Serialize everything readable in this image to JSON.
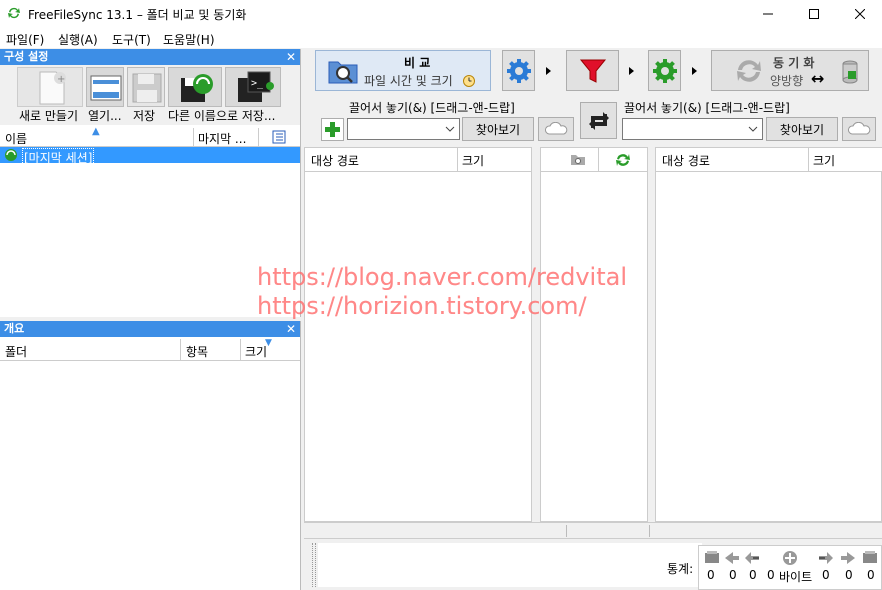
{
  "window": {
    "title": "FreeFileSync 13.1 – 폴더 비교 및 동기화"
  },
  "menu": {
    "items": [
      "파일(F)",
      "실행(A)",
      "도구(T)",
      "도움말(H)"
    ]
  },
  "config_panel": {
    "title": "구성 설정",
    "toolbar": {
      "new": "새로 만들기",
      "open": "열기...",
      "save": "저장",
      "save_as": "다른 이름으로 저장..."
    },
    "columns": {
      "name": "이름",
      "last": "마지막 ..."
    },
    "rows": [
      {
        "label": "[마지막 세션]"
      }
    ]
  },
  "overview_panel": {
    "title": "개요",
    "columns": {
      "folder": "폴더",
      "items": "항목",
      "size": "크기"
    }
  },
  "compare": {
    "label": "비 교",
    "sub": "파일 시간 및 크기"
  },
  "sync": {
    "label": "동 기 화",
    "sub": "양방향"
  },
  "left_folder": {
    "drag_label": "끌어서 놓기(&) [드래그-앤-드랍]",
    "browse": "찾아보기",
    "value": ""
  },
  "right_folder": {
    "drag_label": "끌어서 놓기(&) [드래그-앤-드랍]",
    "browse": "찾아보기",
    "value": ""
  },
  "grid": {
    "left": {
      "path": "대상 경로",
      "size": "크기"
    },
    "right": {
      "path": "대상 경로",
      "size": "크기"
    }
  },
  "watermark": {
    "line1": "https://blog.naver.com/redvital",
    "line2": "https://horizion.tistory.com/"
  },
  "stats": {
    "label": "통계:",
    "values": [
      "0",
      "0",
      "0",
      "0",
      "바이트",
      "0",
      "0",
      "0"
    ]
  },
  "colors": {
    "accent": "#3d8ee6",
    "selection": "#3399ff",
    "filter": "#e0102a",
    "gear": "#2a7bd6",
    "green": "#2a9c2a"
  }
}
